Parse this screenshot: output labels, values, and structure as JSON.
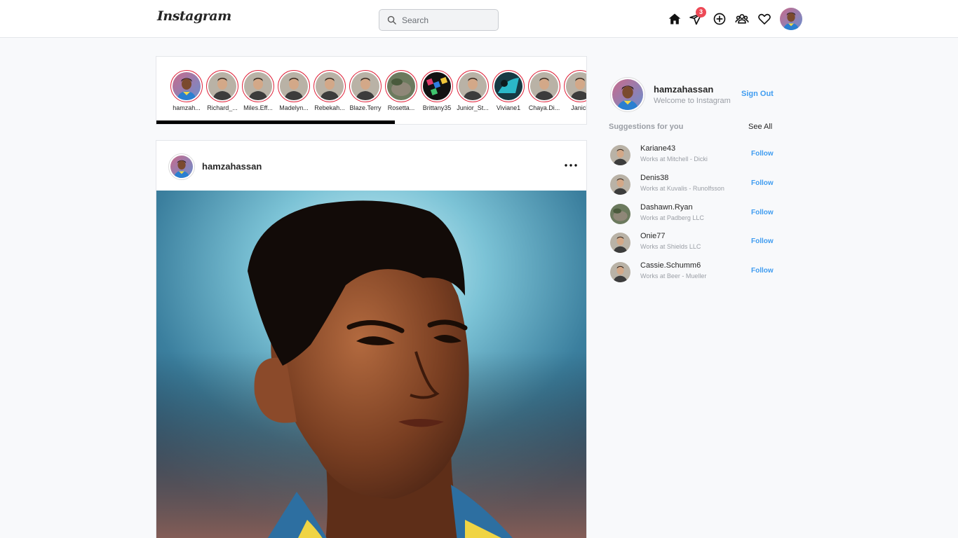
{
  "header": {
    "logo": "Instagram",
    "search_placeholder": "Search",
    "messages_badge": "3",
    "icons": [
      "home-icon",
      "send-icon",
      "add-post-icon",
      "people-icon",
      "heart-icon"
    ]
  },
  "stories": [
    {
      "name": "hamzah..."
    },
    {
      "name": "Richard_..."
    },
    {
      "name": "Miles.Eff..."
    },
    {
      "name": "Madelyn..."
    },
    {
      "name": "Rebekah..."
    },
    {
      "name": "Blaze.Terry"
    },
    {
      "name": "Rosetta..."
    },
    {
      "name": "Brittany35"
    },
    {
      "name": "Junior_St..."
    },
    {
      "name": "Viviane1"
    },
    {
      "name": "Chaya.Di..."
    },
    {
      "name": "Janick"
    }
  ],
  "post": {
    "username": "hamzahassan",
    "more_icon": "more-horizontal-icon"
  },
  "sidebar": {
    "username": "hamzahassan",
    "subtitle": "Welcome to Instagram",
    "sign_out": "Sign Out",
    "suggestions_title": "Suggestions for you",
    "see_all": "See All",
    "follow_label": "Follow",
    "suggestions": [
      {
        "name": "Kariane43",
        "work": "Works at Mitchell - Dicki"
      },
      {
        "name": "Denis38",
        "work": "Works at Kuvalis - Runolfsson"
      },
      {
        "name": "Dashawn.Ryan",
        "work": "Works at Padberg LLC"
      },
      {
        "name": "Onie77",
        "work": "Works at Shields LLC"
      },
      {
        "name": "Cassie.Schumm6",
        "work": "Works at Beer - Mueller"
      }
    ]
  },
  "colors": {
    "accent": "#3f9cf0",
    "story_ring": "#e0263d",
    "badge": "#ed4956"
  }
}
